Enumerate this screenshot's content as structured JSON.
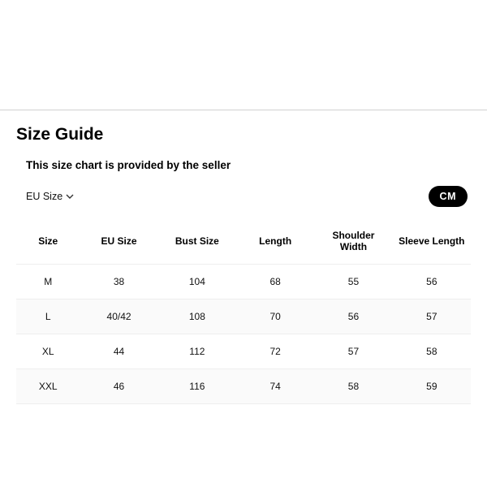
{
  "title": "Size Guide",
  "subtitle": "This size chart is provided by the seller",
  "dropdown": {
    "label": "EU Size"
  },
  "unit_pill": "CM",
  "table": {
    "headers": [
      "Size",
      "EU Size",
      "Bust Size",
      "Length",
      "Shoulder Width",
      "Sleeve Length"
    ],
    "rows": [
      [
        "M",
        "38",
        "104",
        "68",
        "55",
        "56"
      ],
      [
        "L",
        "40/42",
        "108",
        "70",
        "56",
        "57"
      ],
      [
        "XL",
        "44",
        "112",
        "72",
        "57",
        "58"
      ],
      [
        "XXL",
        "46",
        "116",
        "74",
        "58",
        "59"
      ]
    ]
  }
}
